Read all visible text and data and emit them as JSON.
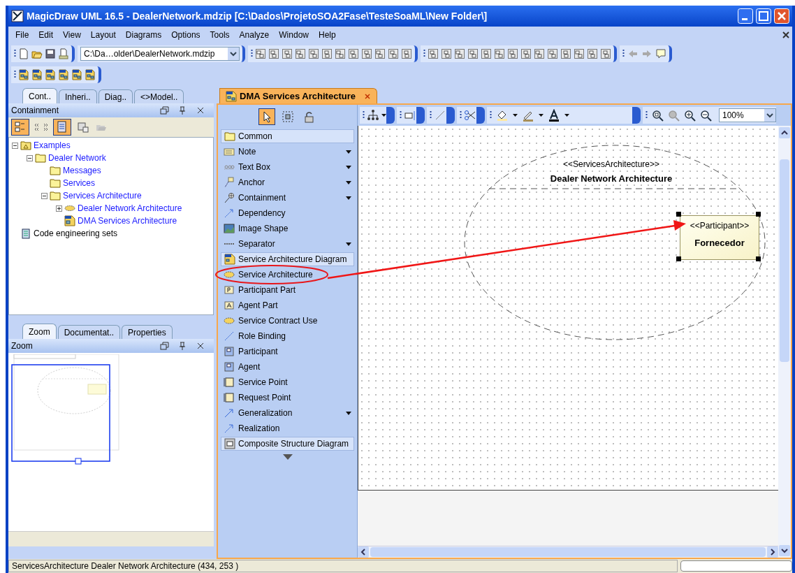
{
  "window": {
    "title": "MagicDraw UML 16.5 - DealerNetwork.mdzip [C:\\Dados\\ProjetoSOA2Fase\\TesteSoaML\\New Folder\\]"
  },
  "menu": [
    "File",
    "Edit",
    "View",
    "Layout",
    "Diagrams",
    "Options",
    "Tools",
    "Analyze",
    "Window",
    "Help"
  ],
  "toolbar": {
    "path_combo": "C:\\Da…older\\DealerNetwork.mdzip"
  },
  "browser_tabs": [
    {
      "label": "Cont..",
      "selected": true
    },
    {
      "label": "Inheri..",
      "selected": false
    },
    {
      "label": "Diag..",
      "selected": false
    },
    {
      "label": "<>Model..",
      "selected": false
    }
  ],
  "containment": {
    "title": "Containment",
    "toggles": [
      {
        "on": true
      },
      {
        "on": false
      },
      {
        "on": true
      },
      {
        "on": false
      }
    ],
    "tree": [
      {
        "label": "Examples",
        "kind": "model",
        "expanded": true,
        "children": [
          {
            "label": "Dealer Network",
            "kind": "package",
            "expanded": true,
            "children": [
              {
                "label": "Messages",
                "kind": "package"
              },
              {
                "label": "Services",
                "kind": "package"
              },
              {
                "label": "Services Architecture",
                "kind": "package",
                "expanded": true,
                "children": [
                  {
                    "label": "Dealer Network Architecture",
                    "kind": "architecture",
                    "expanded": false
                  },
                  {
                    "label": "DMA Services Architecture",
                    "kind": "diagram"
                  }
                ]
              }
            ]
          }
        ]
      },
      {
        "label": "Code engineering sets",
        "kind": "sets"
      }
    ]
  },
  "bottom_tabs": [
    {
      "label": "Zoom",
      "selected": true
    },
    {
      "label": "Documentat..",
      "selected": false
    },
    {
      "label": "Properties",
      "selected": false
    }
  ],
  "zoom_panel": {
    "title": "Zoom"
  },
  "editor_tab": {
    "label": "DMA Services Architecture",
    "selected": true
  },
  "palette": {
    "tools": [
      {
        "kind": "pointer",
        "selected": true
      },
      {
        "kind": "marquee",
        "selected": false
      },
      {
        "kind": "lock",
        "selected": false
      }
    ],
    "items": [
      {
        "kind": "group",
        "label": "Common"
      },
      {
        "kind": "tool",
        "label": "Note",
        "dropdown": true
      },
      {
        "kind": "tool",
        "label": "Text Box",
        "dropdown": true
      },
      {
        "kind": "tool",
        "label": "Anchor",
        "dropdown": true
      },
      {
        "kind": "tool",
        "label": "Containment",
        "dropdown": true
      },
      {
        "kind": "tool",
        "label": "Dependency",
        "dropdown": false
      },
      {
        "kind": "tool",
        "label": "Image Shape",
        "dropdown": false
      },
      {
        "kind": "tool",
        "label": "Separator",
        "dropdown": true
      },
      {
        "kind": "group",
        "label": "Service Architecture Diagram"
      },
      {
        "kind": "tool",
        "label": "Service Architecture",
        "dropdown": false
      },
      {
        "kind": "tool",
        "label": "Participant Part",
        "dropdown": false
      },
      {
        "kind": "tool",
        "label": "Agent Part",
        "dropdown": false
      },
      {
        "kind": "tool",
        "label": "Service Contract Use",
        "dropdown": false
      },
      {
        "kind": "tool",
        "label": "Role Binding",
        "dropdown": false
      },
      {
        "kind": "tool",
        "label": "Participant",
        "dropdown": false
      },
      {
        "kind": "tool",
        "label": "Agent",
        "dropdown": false
      },
      {
        "kind": "tool",
        "label": "Service Point",
        "dropdown": false
      },
      {
        "kind": "tool",
        "label": "Request Point",
        "dropdown": false
      },
      {
        "kind": "tool",
        "label": "Generalization",
        "dropdown": true
      },
      {
        "kind": "tool",
        "label": "Realization",
        "dropdown": false
      },
      {
        "kind": "group",
        "label": "Composite Structure Diagram"
      }
    ]
  },
  "diagram_toolbar": {
    "zoom": "100%"
  },
  "diagram": {
    "architecture": {
      "stereotype": "<<ServicesArchitecture>>",
      "name": "Dealer Network Architecture"
    },
    "participant": {
      "stereotype": "<<Participant>>",
      "name": "Fornecedor",
      "selected": true
    }
  },
  "status_bar": {
    "text": "ServicesArchitecture Dealer Network Architecture  (434, 253 )"
  }
}
